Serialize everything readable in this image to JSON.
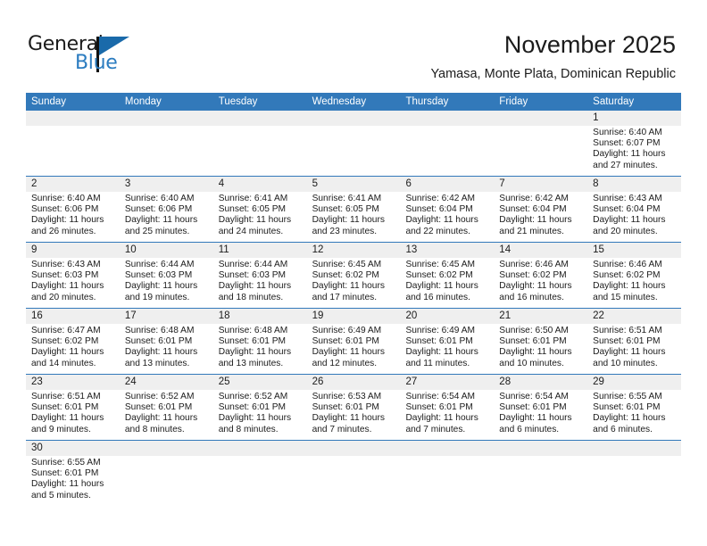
{
  "brand": {
    "name_top": "General",
    "name_bottom": "Blue",
    "accent_color": "#2b7cc0",
    "flag_color": "#1a6aaa"
  },
  "header": {
    "title": "November 2025",
    "subtitle": "Yamasa, Monte Plata, Dominican Republic"
  },
  "calendar": {
    "header_bg": "#3279ba",
    "daynum_band_bg": "#efefef",
    "weekdays": [
      "Sunday",
      "Monday",
      "Tuesday",
      "Wednesday",
      "Thursday",
      "Friday",
      "Saturday"
    ],
    "weeks": [
      [
        {
          "day": "",
          "lines": []
        },
        {
          "day": "",
          "lines": []
        },
        {
          "day": "",
          "lines": []
        },
        {
          "day": "",
          "lines": []
        },
        {
          "day": "",
          "lines": []
        },
        {
          "day": "",
          "lines": []
        },
        {
          "day": "1",
          "lines": [
            "Sunrise: 6:40 AM",
            "Sunset: 6:07 PM",
            "Daylight: 11 hours",
            "and 27 minutes."
          ]
        }
      ],
      [
        {
          "day": "2",
          "lines": [
            "Sunrise: 6:40 AM",
            "Sunset: 6:06 PM",
            "Daylight: 11 hours",
            "and 26 minutes."
          ]
        },
        {
          "day": "3",
          "lines": [
            "Sunrise: 6:40 AM",
            "Sunset: 6:06 PM",
            "Daylight: 11 hours",
            "and 25 minutes."
          ]
        },
        {
          "day": "4",
          "lines": [
            "Sunrise: 6:41 AM",
            "Sunset: 6:05 PM",
            "Daylight: 11 hours",
            "and 24 minutes."
          ]
        },
        {
          "day": "5",
          "lines": [
            "Sunrise: 6:41 AM",
            "Sunset: 6:05 PM",
            "Daylight: 11 hours",
            "and 23 minutes."
          ]
        },
        {
          "day": "6",
          "lines": [
            "Sunrise: 6:42 AM",
            "Sunset: 6:04 PM",
            "Daylight: 11 hours",
            "and 22 minutes."
          ]
        },
        {
          "day": "7",
          "lines": [
            "Sunrise: 6:42 AM",
            "Sunset: 6:04 PM",
            "Daylight: 11 hours",
            "and 21 minutes."
          ]
        },
        {
          "day": "8",
          "lines": [
            "Sunrise: 6:43 AM",
            "Sunset: 6:04 PM",
            "Daylight: 11 hours",
            "and 20 minutes."
          ]
        }
      ],
      [
        {
          "day": "9",
          "lines": [
            "Sunrise: 6:43 AM",
            "Sunset: 6:03 PM",
            "Daylight: 11 hours",
            "and 20 minutes."
          ]
        },
        {
          "day": "10",
          "lines": [
            "Sunrise: 6:44 AM",
            "Sunset: 6:03 PM",
            "Daylight: 11 hours",
            "and 19 minutes."
          ]
        },
        {
          "day": "11",
          "lines": [
            "Sunrise: 6:44 AM",
            "Sunset: 6:03 PM",
            "Daylight: 11 hours",
            "and 18 minutes."
          ]
        },
        {
          "day": "12",
          "lines": [
            "Sunrise: 6:45 AM",
            "Sunset: 6:02 PM",
            "Daylight: 11 hours",
            "and 17 minutes."
          ]
        },
        {
          "day": "13",
          "lines": [
            "Sunrise: 6:45 AM",
            "Sunset: 6:02 PM",
            "Daylight: 11 hours",
            "and 16 minutes."
          ]
        },
        {
          "day": "14",
          "lines": [
            "Sunrise: 6:46 AM",
            "Sunset: 6:02 PM",
            "Daylight: 11 hours",
            "and 16 minutes."
          ]
        },
        {
          "day": "15",
          "lines": [
            "Sunrise: 6:46 AM",
            "Sunset: 6:02 PM",
            "Daylight: 11 hours",
            "and 15 minutes."
          ]
        }
      ],
      [
        {
          "day": "16",
          "lines": [
            "Sunrise: 6:47 AM",
            "Sunset: 6:02 PM",
            "Daylight: 11 hours",
            "and 14 minutes."
          ]
        },
        {
          "day": "17",
          "lines": [
            "Sunrise: 6:48 AM",
            "Sunset: 6:01 PM",
            "Daylight: 11 hours",
            "and 13 minutes."
          ]
        },
        {
          "day": "18",
          "lines": [
            "Sunrise: 6:48 AM",
            "Sunset: 6:01 PM",
            "Daylight: 11 hours",
            "and 13 minutes."
          ]
        },
        {
          "day": "19",
          "lines": [
            "Sunrise: 6:49 AM",
            "Sunset: 6:01 PM",
            "Daylight: 11 hours",
            "and 12 minutes."
          ]
        },
        {
          "day": "20",
          "lines": [
            "Sunrise: 6:49 AM",
            "Sunset: 6:01 PM",
            "Daylight: 11 hours",
            "and 11 minutes."
          ]
        },
        {
          "day": "21",
          "lines": [
            "Sunrise: 6:50 AM",
            "Sunset: 6:01 PM",
            "Daylight: 11 hours",
            "and 10 minutes."
          ]
        },
        {
          "day": "22",
          "lines": [
            "Sunrise: 6:51 AM",
            "Sunset: 6:01 PM",
            "Daylight: 11 hours",
            "and 10 minutes."
          ]
        }
      ],
      [
        {
          "day": "23",
          "lines": [
            "Sunrise: 6:51 AM",
            "Sunset: 6:01 PM",
            "Daylight: 11 hours",
            "and 9 minutes."
          ]
        },
        {
          "day": "24",
          "lines": [
            "Sunrise: 6:52 AM",
            "Sunset: 6:01 PM",
            "Daylight: 11 hours",
            "and 8 minutes."
          ]
        },
        {
          "day": "25",
          "lines": [
            "Sunrise: 6:52 AM",
            "Sunset: 6:01 PM",
            "Daylight: 11 hours",
            "and 8 minutes."
          ]
        },
        {
          "day": "26",
          "lines": [
            "Sunrise: 6:53 AM",
            "Sunset: 6:01 PM",
            "Daylight: 11 hours",
            "and 7 minutes."
          ]
        },
        {
          "day": "27",
          "lines": [
            "Sunrise: 6:54 AM",
            "Sunset: 6:01 PM",
            "Daylight: 11 hours",
            "and 7 minutes."
          ]
        },
        {
          "day": "28",
          "lines": [
            "Sunrise: 6:54 AM",
            "Sunset: 6:01 PM",
            "Daylight: 11 hours",
            "and 6 minutes."
          ]
        },
        {
          "day": "29",
          "lines": [
            "Sunrise: 6:55 AM",
            "Sunset: 6:01 PM",
            "Daylight: 11 hours",
            "and 6 minutes."
          ]
        }
      ],
      [
        {
          "day": "30",
          "lines": [
            "Sunrise: 6:55 AM",
            "Sunset: 6:01 PM",
            "Daylight: 11 hours",
            "and 5 minutes."
          ]
        },
        {
          "day": "",
          "lines": []
        },
        {
          "day": "",
          "lines": []
        },
        {
          "day": "",
          "lines": []
        },
        {
          "day": "",
          "lines": []
        },
        {
          "day": "",
          "lines": []
        },
        {
          "day": "",
          "lines": []
        }
      ]
    ]
  }
}
